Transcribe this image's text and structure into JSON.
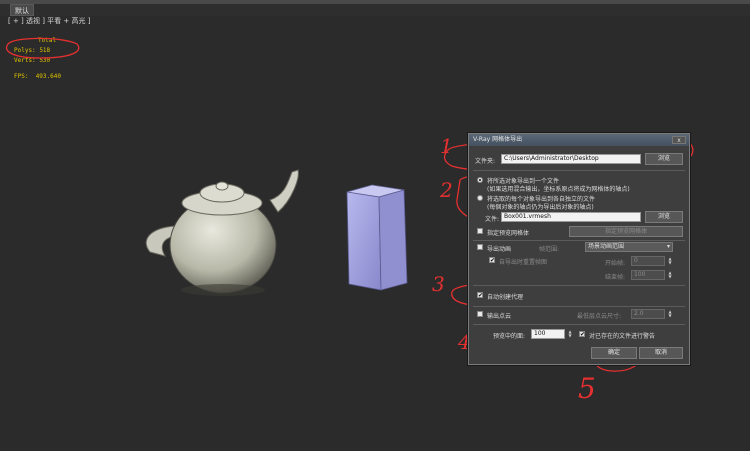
{
  "tab": {
    "label": "默认"
  },
  "viewport": {
    "label": "[ + ] 透视 ] 平看 + 高光 ]"
  },
  "stats": {
    "total_label": "Total",
    "polys_label": "Polys:",
    "polys_value": "518",
    "verts_label": "Verts:",
    "verts_value": "530",
    "fps_label": "FPS:",
    "fps_value": "493.640"
  },
  "annotations": [
    "1",
    "2",
    "3",
    "4",
    "5"
  ],
  "dialog": {
    "title": "V-Ray 网格体导出",
    "close_label": "x",
    "folder_label": "文件夹:",
    "folder_value": "C:\\Users\\Administrator\\Desktop",
    "browse1_label": "浏览",
    "radio1_line1": "将所选对象导出到一个文件",
    "radio1_line2": "(如果选用混合输出，坐标系原点将成为网格体的轴点)",
    "radio2_line1": "将选取的每个对象导出到各自独立的文件",
    "radio2_line2": "(每個对象的轴点仍为导出后对象的轴点)",
    "file_label": "文件:",
    "file_value": "Box001.vrmesh",
    "browse2_label": "浏览",
    "specify_preview_label": "指定预览网格体",
    "specify_preview_btn": "指定预览网格体",
    "export_anim_label": "导出动画",
    "frame_range_label": "帧范围:",
    "frame_range_value": "场景动画范围",
    "auto_faces_label": "自导出时重置帧图",
    "start_frame_label": "开始帧:",
    "start_frame_value": "0",
    "end_frame_label": "结束帧:",
    "end_frame_value": "100",
    "auto_proxy_label": "自动创建代理",
    "export_pointcloud_label": "输出点云",
    "min_point_label": "最低层点云尺寸:",
    "min_point_value": "2.0",
    "preview_faces_label": "预览中的面:",
    "preview_faces_value": "100",
    "warn_overwrite_label": "对已存在的文件进行警告",
    "ok_label": "确定",
    "cancel_label": "取消"
  }
}
